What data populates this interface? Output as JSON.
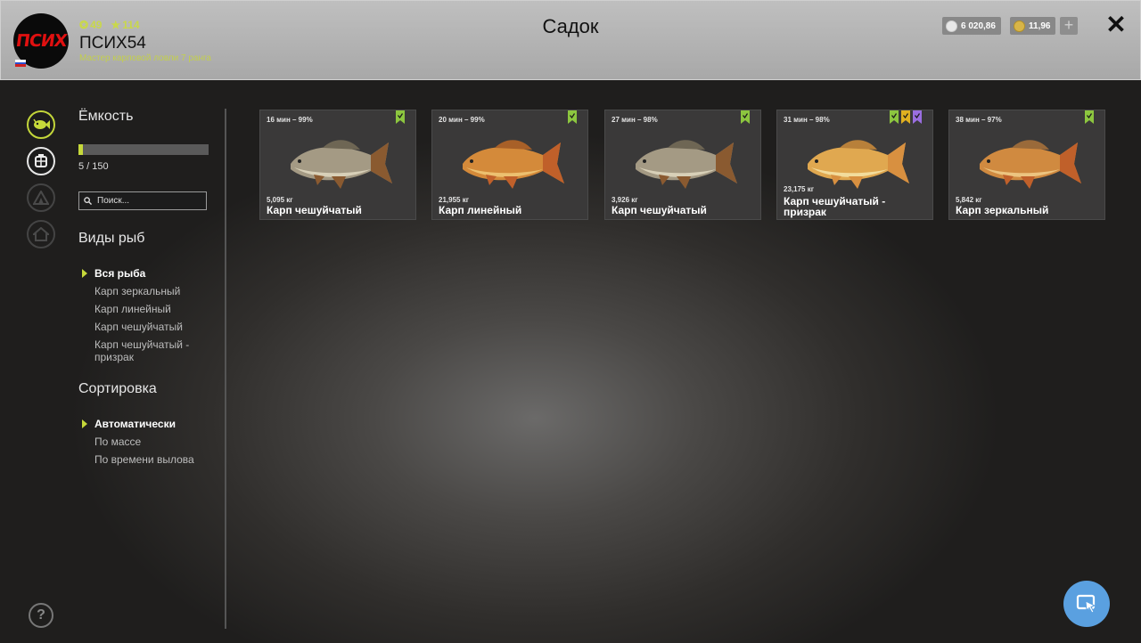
{
  "header": {
    "title": "Садок",
    "avatar_text": "ПСИХ",
    "player_name": "ПСИХ54",
    "player_rank": "Мастер карповой ловли 7 ранга",
    "stat_level": "49",
    "stat_stars": "114",
    "silver": "6 020,86",
    "gold": "11,96"
  },
  "sidebar": {
    "capacity_heading": "Ёмкость",
    "capacity_text": "5 / 150",
    "capacity_fraction": 0.033,
    "search_placeholder": "Поиск...",
    "species_heading": "Виды рыб",
    "species": [
      {
        "label": "Вся рыба",
        "selected": true
      },
      {
        "label": "Карп зеркальный",
        "selected": false
      },
      {
        "label": "Карп линейный",
        "selected": false
      },
      {
        "label": "Карп чешуйчатый",
        "selected": false
      },
      {
        "label": "Карп чешуйчатый - призрак",
        "selected": false
      }
    ],
    "sort_heading": "Сортировка",
    "sort": [
      {
        "label": "Автоматически",
        "selected": true
      },
      {
        "label": "По массе",
        "selected": false
      },
      {
        "label": "По времени вылова",
        "selected": false
      }
    ]
  },
  "fish": [
    {
      "meta": "16 мин – 99%",
      "weight": "5,095 кг",
      "name": "Карп чешуйчатый",
      "kind": "scaled",
      "flags": [
        "#8cc63f"
      ]
    },
    {
      "meta": "20 мин – 99%",
      "weight": "21,955 кг",
      "name": "Карп линейный",
      "kind": "linear",
      "flags": [
        "#8cc63f"
      ]
    },
    {
      "meta": "27 мин – 98%",
      "weight": "3,926 кг",
      "name": "Карп чешуйчатый",
      "kind": "scaled",
      "flags": [
        "#8cc63f"
      ]
    },
    {
      "meta": "31 мин – 98%",
      "weight": "23,175 кг",
      "name": "Карп чешуйчатый - призрак",
      "kind": "ghost",
      "flags": [
        "#8cc63f",
        "#e0b020",
        "#9a6ee0"
      ]
    },
    {
      "meta": "38 мин – 97%",
      "weight": "5,842 кг",
      "name": "Карп зеркальный",
      "kind": "mirror",
      "flags": [
        "#8cc63f"
      ]
    }
  ],
  "colors": {
    "accent": "#c6d93a",
    "fab": "#5aa0e0"
  },
  "icons": {
    "nav": [
      "fish-icon",
      "keepnet-icon",
      "tent-icon",
      "house-icon"
    ],
    "help": "?",
    "close": "✕",
    "plus": "+"
  }
}
